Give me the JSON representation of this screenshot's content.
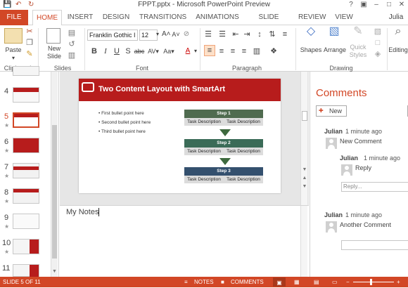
{
  "window": {
    "title": "FPPT.pptx - Microsoft PowerPoint Preview"
  },
  "tabs": [
    {
      "label": "FILE"
    },
    {
      "label": "HOME"
    },
    {
      "label": "INSERT"
    },
    {
      "label": "DESIGN"
    },
    {
      "label": "TRANSITIONS"
    },
    {
      "label": "ANIMATIONS"
    },
    {
      "label": "SLIDE SHOW"
    },
    {
      "label": "REVIEW"
    },
    {
      "label": "VIEW"
    }
  ],
  "user": "Julia",
  "ribbon": {
    "clipboard": {
      "paste_label": "Paste",
      "group_label": "Clipboard"
    },
    "slides": {
      "new_slide_label": "New\nSlide",
      "group_label": "Slides"
    },
    "font": {
      "font_name": "Franklin Gothic I",
      "font_size": "12",
      "group_label": "Font"
    },
    "paragraph": {
      "group_label": "Paragraph"
    },
    "drawing": {
      "shapes_label": "Shapes",
      "arrange_label": "Arrange",
      "quick_styles_label": "Quick\nStyles",
      "group_label": "Drawing"
    },
    "editing": {
      "label": "Editing"
    }
  },
  "thumbnails": [
    {
      "num": "4"
    },
    {
      "num": "5"
    },
    {
      "num": "6"
    },
    {
      "num": "7"
    },
    {
      "num": "8"
    },
    {
      "num": "9"
    },
    {
      "num": "10"
    },
    {
      "num": "11"
    }
  ],
  "slide": {
    "title": "Two Content Layout with SmartArt",
    "bullets": [
      "First bullet point here",
      "Second bullet point here",
      "Third bullet point here"
    ],
    "steps": [
      {
        "label": "Step 1",
        "desc1": "Task Description",
        "desc2": "Task Description",
        "color": "#4f6b4f"
      },
      {
        "label": "Step 2",
        "desc1": "Task Description",
        "desc2": "Task Description",
        "color": "#3a6b57"
      },
      {
        "label": "Step 3",
        "desc1": "Task Description",
        "desc2": "Task Description",
        "color": "#34506e"
      }
    ],
    "title_color": "#b71c1c"
  },
  "notes": {
    "text": "My Notes"
  },
  "comments": {
    "heading": "Comments",
    "new_label": "New",
    "threads": [
      {
        "author": "Julian",
        "time": "1 minute ago",
        "text": "New Comment",
        "reply": {
          "author": "Julian",
          "time": "1 minute ago",
          "text": "Reply"
        },
        "reply_placeholder": "Reply..."
      },
      {
        "author": "Julian",
        "time": "1 minute ago",
        "text": "Another Comment"
      }
    ]
  },
  "status": {
    "slide_info": "SLIDE 5 OF 11",
    "notes_label": "NOTES",
    "comments_label": "COMMENTS"
  },
  "colors": {
    "accent": "#d24726"
  }
}
